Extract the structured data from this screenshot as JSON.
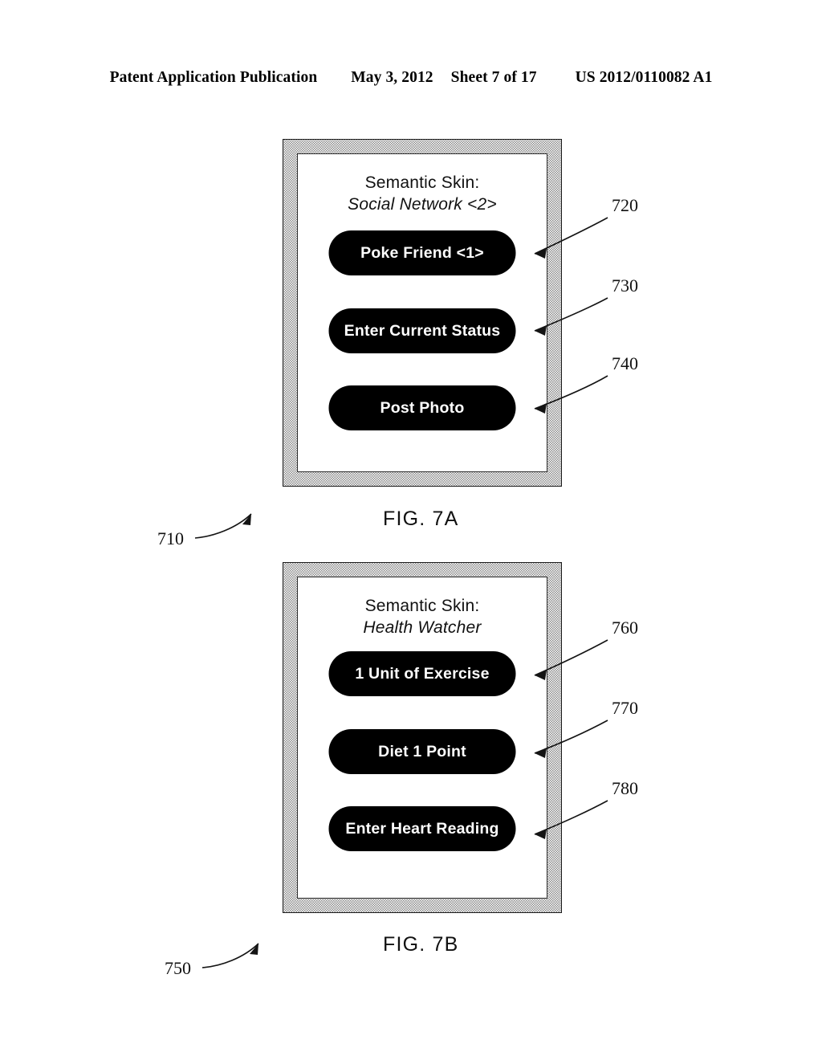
{
  "header": {
    "publication": "Patent Application Publication",
    "date": "May 3, 2012",
    "sheet": "Sheet 7 of 17",
    "number": "US 2012/0110082 A1"
  },
  "figures": [
    {
      "id": "fig-7a",
      "caption": "FIG. 7A",
      "device_ref": "710",
      "skin": {
        "label": "Semantic Skin:",
        "name": "Social Network <2>"
      },
      "buttons": [
        {
          "label": "Poke Friend <1>",
          "ref": "720"
        },
        {
          "label": "Enter Current Status",
          "ref": "730"
        },
        {
          "label": "Post Photo",
          "ref": "740"
        }
      ]
    },
    {
      "id": "fig-7b",
      "caption": "FIG. 7B",
      "device_ref": "750",
      "skin": {
        "label": "Semantic Skin:",
        "name": "Health Watcher"
      },
      "buttons": [
        {
          "label": "1 Unit of Exercise",
          "ref": "760"
        },
        {
          "label": "Diet 1 Point",
          "ref": "770"
        },
        {
          "label": "Enter Heart Reading",
          "ref": "780"
        }
      ]
    }
  ],
  "colors": {
    "button_fill": "#000000",
    "button_text": "#ffffff",
    "line": "#141414",
    "bezel": "#8a8a8a",
    "page_background": "#ffffff"
  }
}
